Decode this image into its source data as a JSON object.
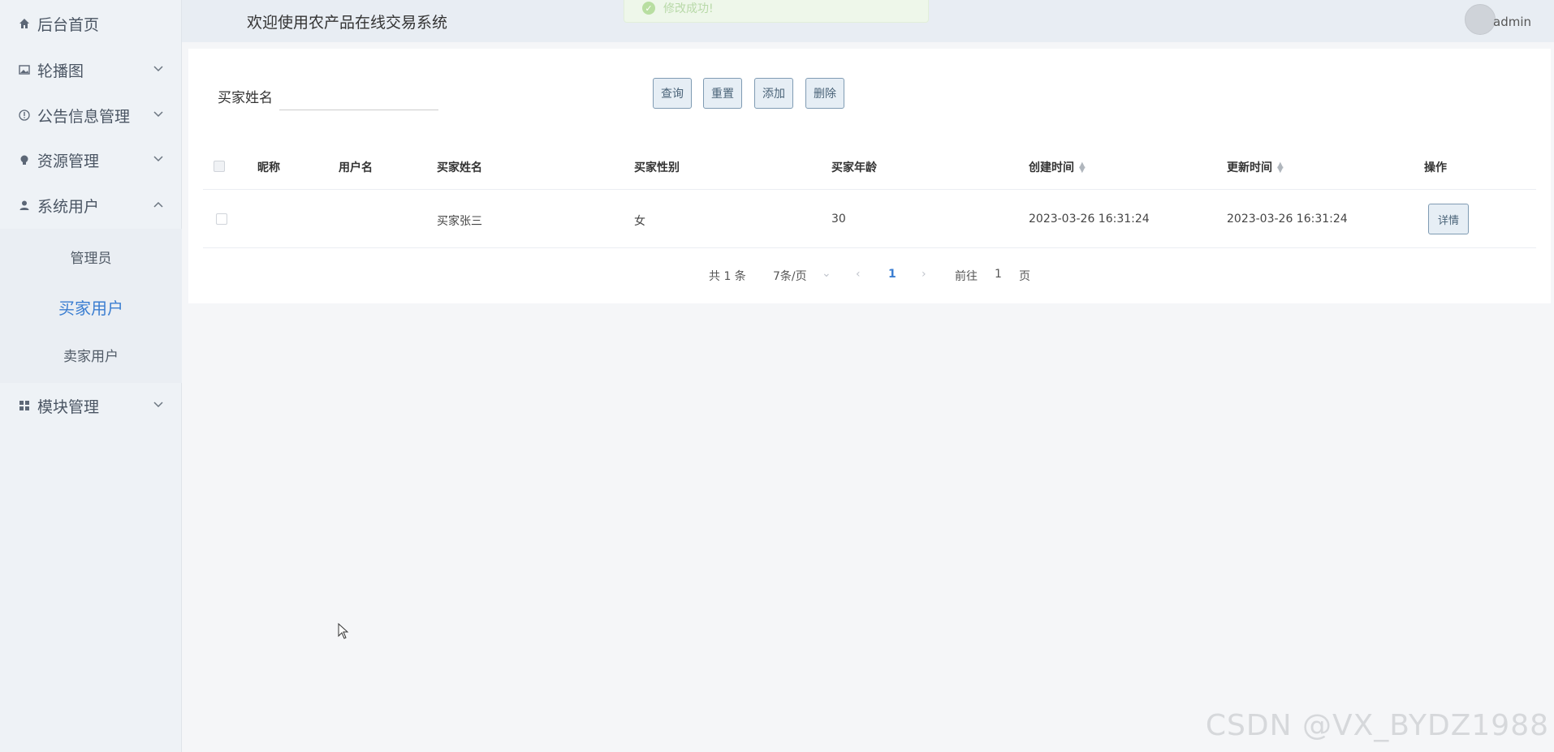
{
  "sidebar": {
    "items": [
      {
        "label": "后台首页",
        "icon": "home-icon"
      },
      {
        "label": "轮播图",
        "icon": "image-icon"
      },
      {
        "label": "公告信息管理",
        "icon": "info-icon"
      },
      {
        "label": "资源管理",
        "icon": "bulb-icon"
      },
      {
        "label": "系统用户",
        "icon": "user-icon"
      },
      {
        "label": "模块管理",
        "icon": "grid-icon"
      }
    ],
    "submenu": [
      {
        "label": "管理员"
      },
      {
        "label": "买家用户"
      },
      {
        "label": "卖家用户"
      }
    ]
  },
  "header": {
    "welcome": "欢迎使用农产品在线交易系统",
    "toast": "修改成功!",
    "username": "admin"
  },
  "search": {
    "label": "买家姓名",
    "value": "",
    "buttons": {
      "query": "查询",
      "reset": "重置",
      "add": "添加",
      "delete": "删除"
    }
  },
  "table": {
    "columns": [
      "昵称",
      "用户名",
      "买家姓名",
      "买家性别",
      "买家年龄",
      "创建时间",
      "更新时间",
      "操作"
    ],
    "rows": [
      {
        "nickname": "",
        "username": "",
        "buyer_name": "买家张三",
        "gender": "女",
        "age": "30",
        "created": "2023-03-26 16:31:24",
        "updated": "2023-03-26 16:31:24",
        "action": "详情"
      }
    ]
  },
  "pagination": {
    "total": "共 1 条",
    "page_size": "7条/页",
    "current": "1",
    "goto_prefix": "前往",
    "goto_value": "1",
    "goto_suffix": "页"
  },
  "watermark": "CSDN @VX_BYDZ1988",
  "colors": {
    "accent": "#3b7ed1",
    "sidebar_bg": "#eef2f6",
    "button_border": "#7f9bb3"
  }
}
